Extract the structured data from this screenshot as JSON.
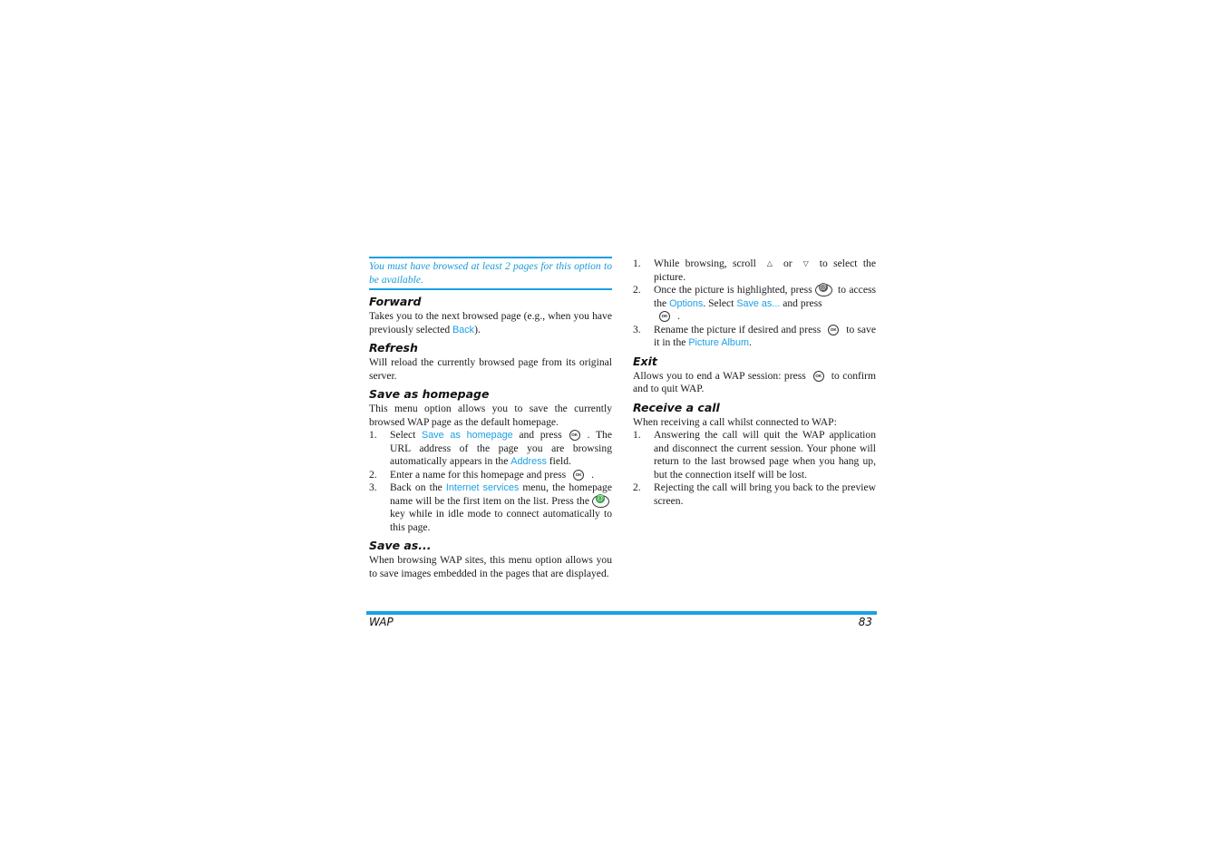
{
  "left_column": {
    "note": "You must have browsed at least 2 pages for this option to be available.",
    "forward": {
      "title": "Forward",
      "text_before": "Takes you to the next browsed page (e.g., when you have previously selected ",
      "link": "Back",
      "text_after": ")."
    },
    "refresh": {
      "title": "Refresh",
      "text": "Will reload the currently browsed page from its original server."
    },
    "save_homepage": {
      "title": "Save as homepage",
      "intro": "This menu option allows you to save the currently browsed WAP page as the default homepage.",
      "steps": [
        {
          "num": "1.",
          "a": "Select ",
          "link": "Save as homepage",
          "b": " and press",
          "c": ". The URL address of the page you are browsing automatically appears in the ",
          "link2": "Address",
          "d": " field."
        },
        {
          "num": "2.",
          "a": "Enter a name for this homepage and press",
          "b": "."
        },
        {
          "num": "3.",
          "a": "Back on the ",
          "link": "Internet services",
          "b": " menu, the homepage name will be the first item on the list. Press the",
          "c": "key while in idle mode to connect automatically to this page."
        }
      ]
    },
    "save_as": {
      "title": "Save as...",
      "text": "When browsing WAP sites, this menu option allows you to save images embedded in the pages that are displayed."
    }
  },
  "right_column": {
    "steps": [
      {
        "num": "1.",
        "a": "While browsing, scroll",
        "or": "or",
        "b": "to select the picture."
      },
      {
        "num": "2.",
        "a": "Once the picture is highlighted, press",
        "b": "to access the ",
        "link": "Options",
        "c": ". Select ",
        "link2": "Save as...",
        "d": " and press",
        "e": "."
      },
      {
        "num": "3.",
        "a": "Rename the picture if desired and press",
        "b": "to save it in the ",
        "link": "Picture Album",
        "c": "."
      }
    ],
    "exit": {
      "title": "Exit",
      "a": "Allows you to end a WAP session: press",
      "b": "to confirm and to quit WAP."
    },
    "receive_call": {
      "title": "Receive a call",
      "intro": "When receiving a call whilst connected to WAP:",
      "steps": [
        {
          "num": "1.",
          "text": "Answering the call will quit the WAP application and disconnect the current session. Your phone will return to the last browsed page when you hang up, but the connection itself will be lost."
        },
        {
          "num": "2.",
          "text": "Rejecting the call will bring you back to the preview screen."
        }
      ]
    }
  },
  "icons": {
    "ok_label": "OK",
    "up_arrow": "△",
    "down_arrow": "▽"
  },
  "footer": {
    "section": "WAP",
    "page_number": "83"
  },
  "colors": {
    "accent": "#1aa0e6",
    "wap_key": "#2e9b3a"
  }
}
